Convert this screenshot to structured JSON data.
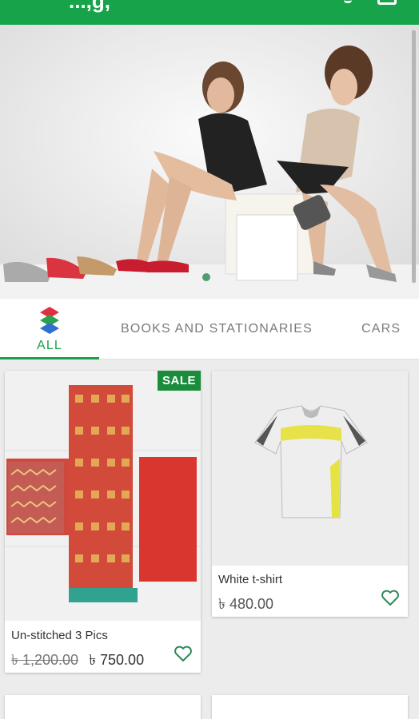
{
  "app_bar": {
    "title": "...,g,",
    "color": "#17a34a"
  },
  "banner": {
    "slide_index": 1,
    "slide_count": 1
  },
  "tabs": [
    {
      "label": "ALL",
      "active": true,
      "icon": "layers-icon"
    },
    {
      "label": "BOOKS AND STATIONARIES",
      "active": false
    },
    {
      "label": "CARS",
      "active": false
    }
  ],
  "products": [
    {
      "name": "Un-stitched 3 Pics",
      "badge": "SALE",
      "old_price": "৳ 1,200.00",
      "price": "৳ 750.00",
      "favorite_icon": "heart-outline-icon"
    },
    {
      "name": "White t-shirt",
      "price": "৳ 480.00",
      "favorite_icon": "heart-outline-icon"
    }
  ],
  "colors": {
    "accent": "#17a34a",
    "sale_badge": "#1b8c3c"
  }
}
